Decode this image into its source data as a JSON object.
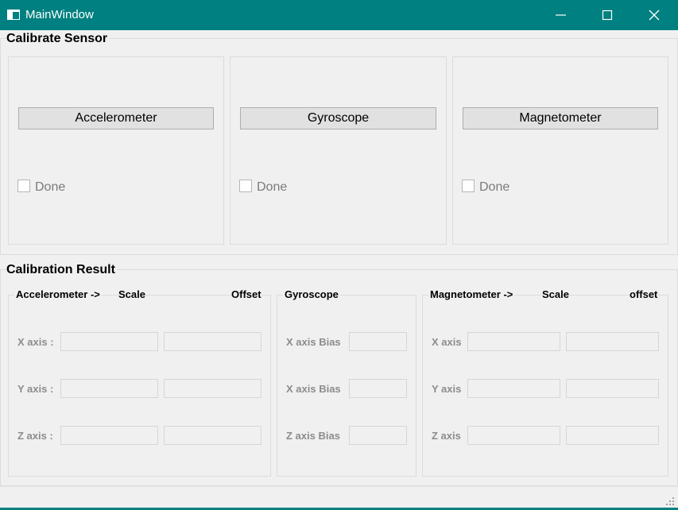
{
  "window": {
    "title": "MainWindow",
    "colors": {
      "titlebar": "#008080",
      "background": "#f0f0f0"
    },
    "icons": [
      "app-window-icon",
      "minimize-icon",
      "maximize-icon",
      "close-icon",
      "size-grip-icon"
    ]
  },
  "calibrate": {
    "title": "Calibrate Sensor",
    "sensors": [
      {
        "button": "Accelerometer",
        "done": "Done",
        "checked": false
      },
      {
        "button": "Gyroscope",
        "done": "Done",
        "checked": false
      },
      {
        "button": "Magnetometer",
        "done": "Done",
        "checked": false
      }
    ]
  },
  "result": {
    "title": "Calibration Result",
    "accel": {
      "header": "Accelerometer ->",
      "scale": "Scale",
      "offset": "Offset",
      "axes": [
        "X axis :",
        "Y axis :",
        "Z axis :"
      ]
    },
    "gyro": {
      "header": "Gyroscope",
      "axes": [
        "X axis Bias",
        "X axis Bias",
        "Z axis Bias"
      ]
    },
    "mag": {
      "header": "Magnetometer ->",
      "scale": "Scale",
      "offset": "offset",
      "axes": [
        "X axis",
        "Y axis",
        "Z axis"
      ]
    }
  }
}
